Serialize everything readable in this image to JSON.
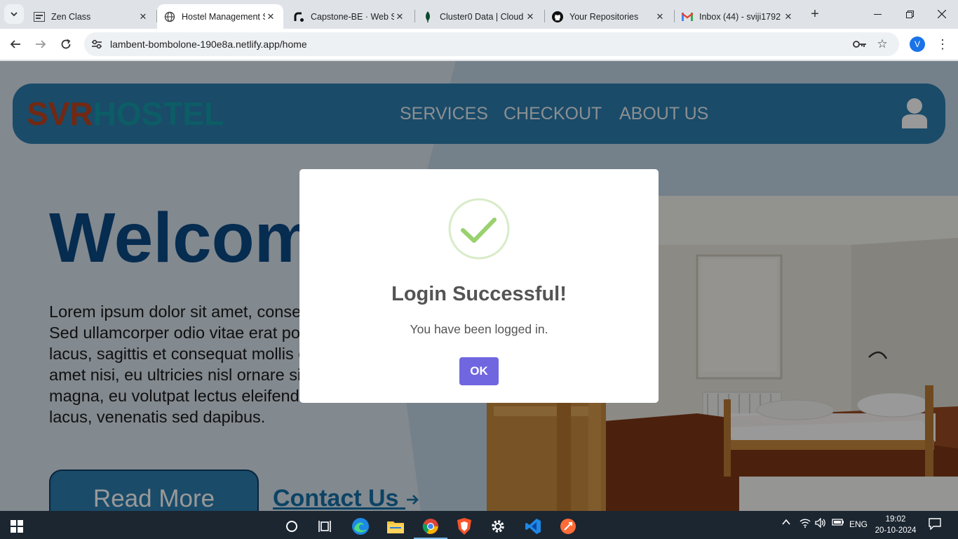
{
  "browser": {
    "tabs": [
      {
        "title": "Zen Class",
        "icon": "zen-class-icon"
      },
      {
        "title": "Hostel Management S",
        "icon": "globe-icon",
        "active": true
      },
      {
        "title": "Capstone-BE · Web S",
        "icon": "render-icon"
      },
      {
        "title": "Cluster0 Data | Cloud",
        "icon": "mongodb-leaf-icon"
      },
      {
        "title": "Your Repositories",
        "icon": "github-icon"
      },
      {
        "title": "Inbox (44) - sviji1792",
        "icon": "gmail-icon"
      }
    ],
    "url": "lambent-bombolone-190e8a.netlify.app/home",
    "profile_initial": "V"
  },
  "site": {
    "logo_part1": "SVR",
    "logo_part2": "HOSTEL",
    "nav": [
      "SERVICES",
      "CHECKOUT",
      "ABOUT US"
    ],
    "welcome": "Welcome",
    "paragraph": "Lorem ipsum dolor sit amet, consectetur adipiscing elit. Sed ullamcorper odio vitae erat posuere. Nam tellus lacus, sagittis et consequat mollis eros. Vestibulum sit amet nisi, eu ultricies nisl ornare sit amet. In placerat magna, eu volutpat lectus eleifend eu. Praesent sem lacus, venenatis sed dapibus.",
    "read_more": "Read More",
    "contact_us": "Contact Us",
    "colors": {
      "header": "#2c7db0",
      "logo_part1": "#c0441e",
      "logo_part2": "#159cab",
      "welcome": "#0b4a86"
    }
  },
  "modal": {
    "title": "Login Successful!",
    "text": "You have been logged in.",
    "ok_label": "OK",
    "icon": "success-checkmark-icon",
    "ok_color": "#7066e0"
  },
  "taskbar": {
    "language": "ENG",
    "time": "19:02",
    "date": "20-10-2024",
    "apps": [
      "start-icon",
      "search-circle-icon",
      "task-view-icon",
      "edge-icon",
      "file-explorer-icon",
      "chrome-icon",
      "brave-icon",
      "settings-icon",
      "vscode-icon",
      "postman-icon"
    ]
  }
}
